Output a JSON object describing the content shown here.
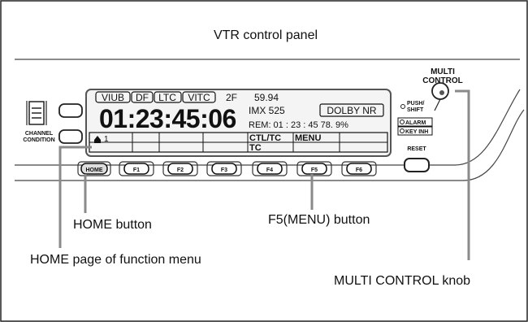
{
  "title": "VTR control panel",
  "display": {
    "tc_labels": [
      "VIUB",
      "DF",
      "LTC",
      "VITC"
    ],
    "field": "2F",
    "frame_rate": "59.94",
    "timecode": "01:23:45:06",
    "format": "IMX 525",
    "dolby": "DOLBY NR",
    "remain": "REM: 01 : 23 : 45  78. 9%",
    "menu_page_num": "1",
    "menu_cells": [
      "CTL/TC",
      "MENU"
    ],
    "menu_cells_row2": [
      "TC"
    ]
  },
  "panel": {
    "channel_condition": "CHANNEL CONDITION",
    "multi_control": "MULTI CONTROL",
    "push_shift": "PUSH/ SHIFT",
    "alarm": "ALARM",
    "key_inh": "KEY INH",
    "reset": "RESET",
    "buttons": [
      "HOME",
      "F1",
      "F2",
      "F3",
      "F4",
      "F5",
      "F6"
    ]
  },
  "callouts": {
    "home_button": "HOME button",
    "f5_button": "F5(MENU) button",
    "home_page": "HOME page of function menu",
    "multi_knob": "MULTI CONTROL knob"
  }
}
